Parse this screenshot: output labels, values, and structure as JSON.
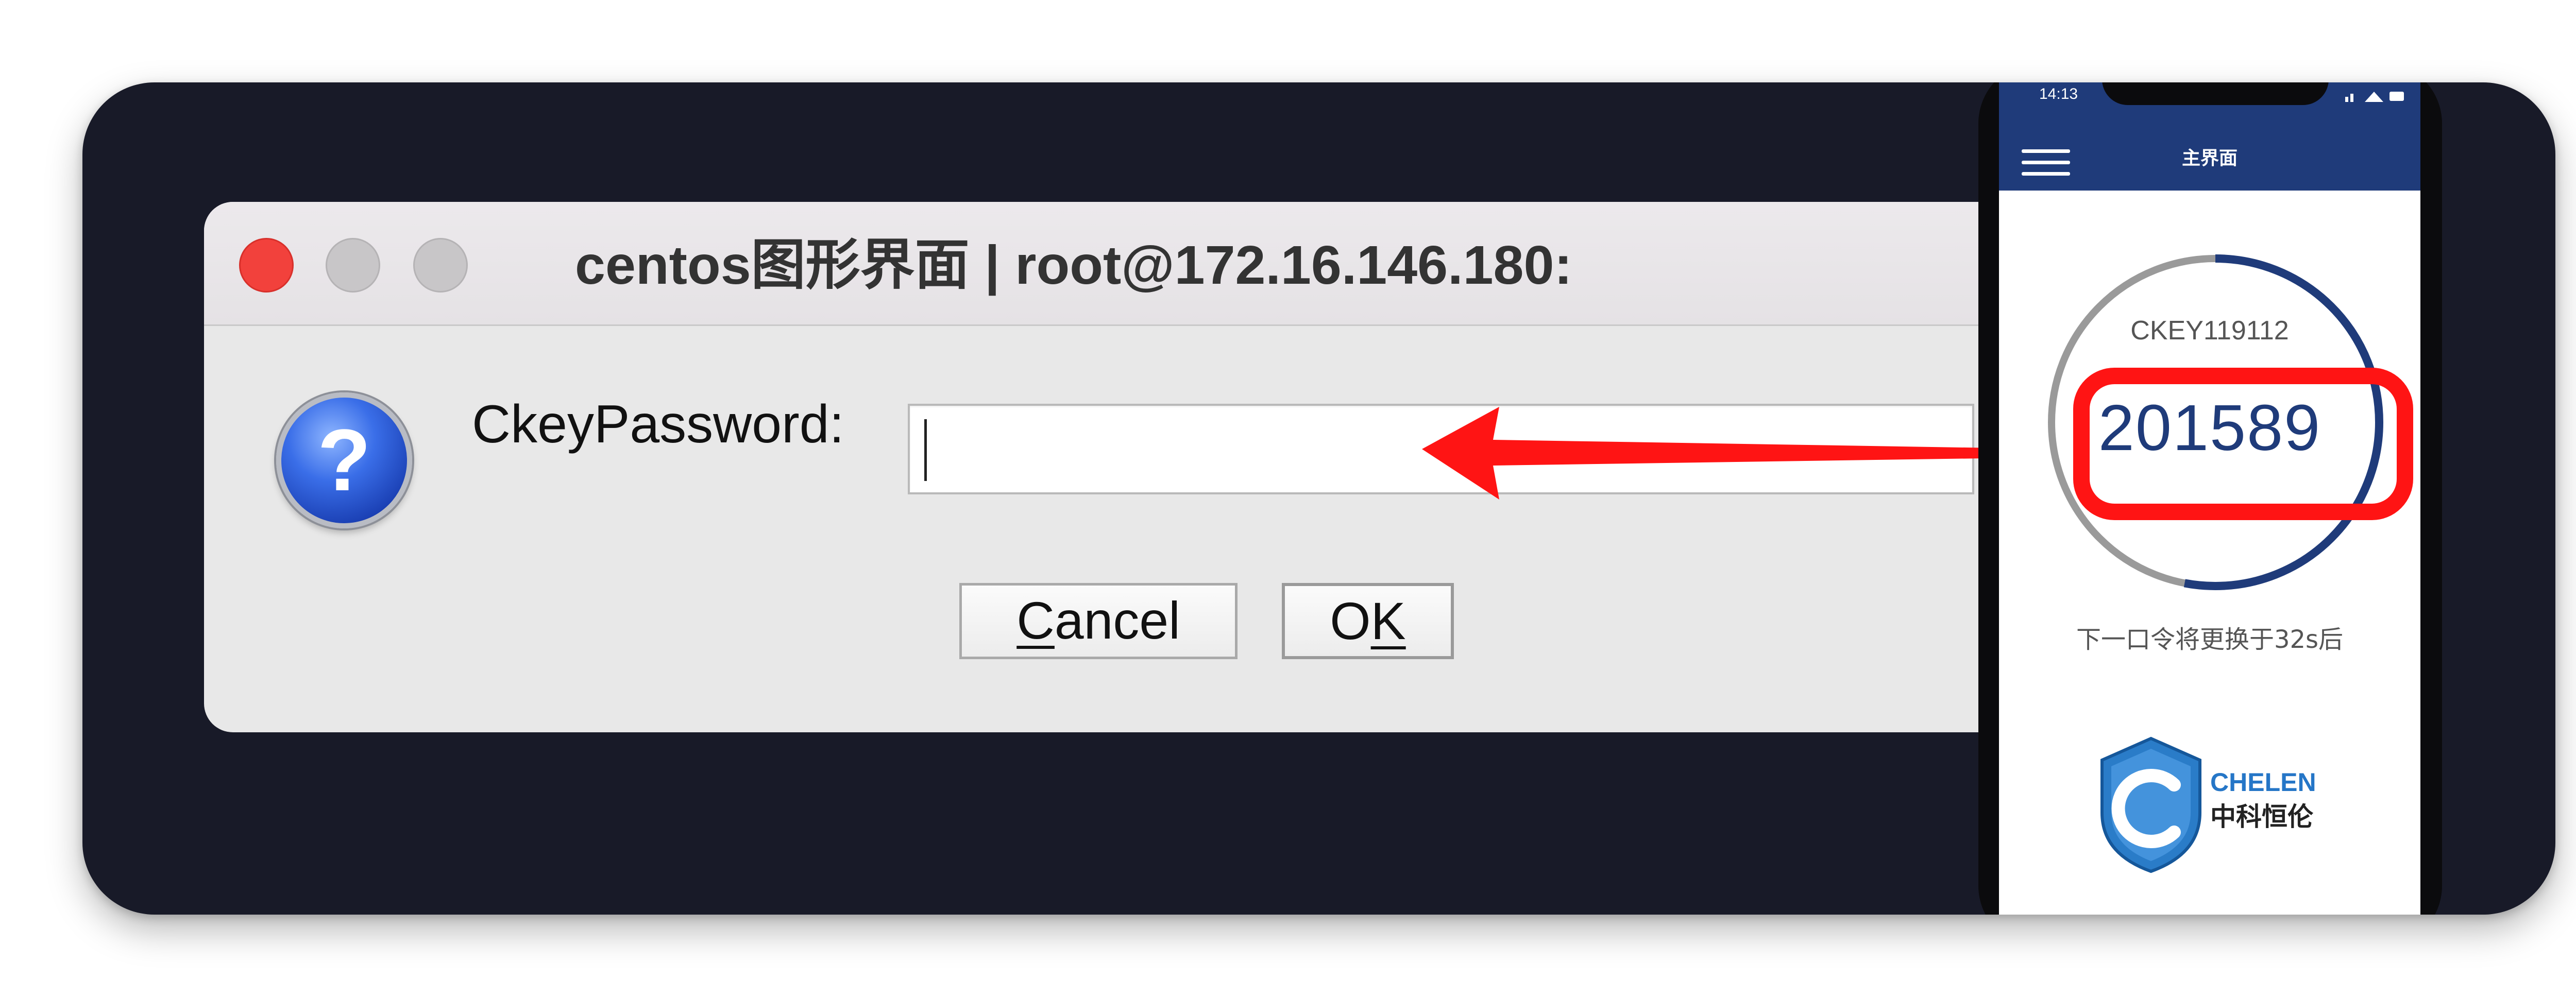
{
  "dialog": {
    "title": "centos图形界面 | root@172.16.146.180:",
    "field_label": "CkeyPassword:",
    "password_value": "",
    "cancel": {
      "pre": "",
      "mnemonic": "C",
      "post": "ancel"
    },
    "ok": {
      "pre": "O",
      "mnemonic": "K",
      "post": ""
    }
  },
  "phone": {
    "status_time": "14:13",
    "screen_title": "主界面",
    "token_id": "CKEY119112",
    "otp": "201589",
    "refresh_note": "下一口令将更换于32s后",
    "logo_en": "CHELEN",
    "logo_cn": "中科恒伦",
    "ring_progress": 0.53
  },
  "colors": {
    "scene_bg": "#181a28",
    "dialog_bg": "#e8e8e8",
    "close_red": "#f2413c",
    "highlight_red": "#ff1414",
    "phone_navy": "#1f3b7a",
    "logo_blue": "#2576c7"
  },
  "icons": [
    "question-icon",
    "menu-icon",
    "shield-logo-icon",
    "arrow-annotation"
  ]
}
